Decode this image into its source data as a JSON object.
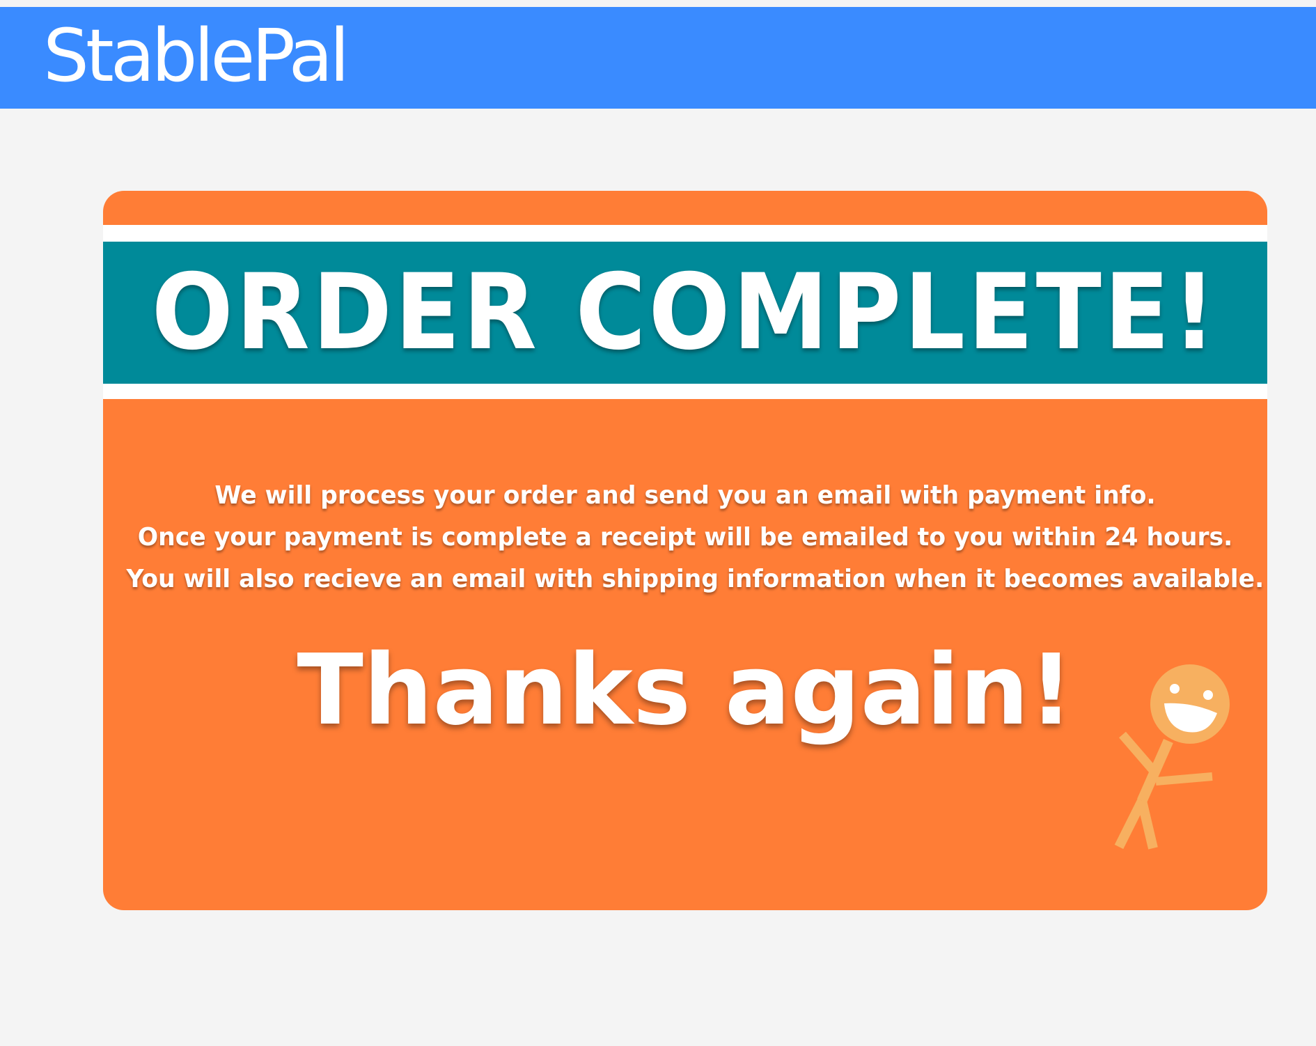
{
  "header": {
    "logo_text": "StablePal",
    "background_color": "#3a8bff"
  },
  "card": {
    "background_color": "#ff7d36",
    "band_color": "#008a99",
    "headline": "ORDER COMPLETE!",
    "message_lines": [
      "We will process your order and send you an email with payment info.",
      "Once your payment is complete a receipt will be emailed to you within 24 hours.",
      "You will also recieve an email with shipping information when it becomes available."
    ],
    "thanks": "Thanks again!",
    "mascot_icon": "happy-stick-figure-icon"
  }
}
